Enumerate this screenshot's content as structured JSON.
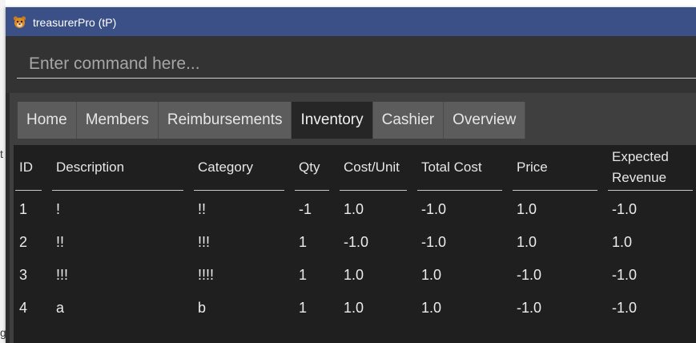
{
  "window": {
    "title": "treasurerPro (tP)",
    "icon": "bear-face-icon"
  },
  "command": {
    "placeholder": "Enter command here..."
  },
  "tabs": [
    {
      "label": "Home",
      "active": false
    },
    {
      "label": "Members",
      "active": false
    },
    {
      "label": "Reimbursements",
      "active": false
    },
    {
      "label": "Inventory",
      "active": true
    },
    {
      "label": "Cashier",
      "active": false
    },
    {
      "label": "Overview",
      "active": false
    }
  ],
  "inventory": {
    "columns": [
      "ID",
      "Description",
      "Category",
      "Qty",
      "Cost/Unit",
      "Total Cost",
      "Price",
      "Expected Revenue"
    ],
    "rows": [
      [
        "1",
        "!",
        "!!",
        "-1",
        "1.0",
        "-1.0",
        "1.0",
        "-1.0"
      ],
      [
        "2",
        "!!",
        "!!!",
        "1",
        "-1.0",
        "-1.0",
        "1.0",
        "1.0"
      ],
      [
        "3",
        "!!!",
        "!!!!",
        "1",
        "1.0",
        "1.0",
        "-1.0",
        "-1.0"
      ],
      [
        "4",
        "a",
        "b",
        "1",
        "1.0",
        "1.0",
        "-1.0",
        "-1.0"
      ]
    ]
  },
  "background": {
    "stray_glyphs": [
      "t",
      "g"
    ]
  },
  "colors": {
    "titlebar": "#3c5088",
    "window_bg": "#2b2b2b",
    "tab_bg": "#5c5c5c",
    "tab_active_bg": "#262626",
    "table_bg": "#1f1f1f"
  }
}
